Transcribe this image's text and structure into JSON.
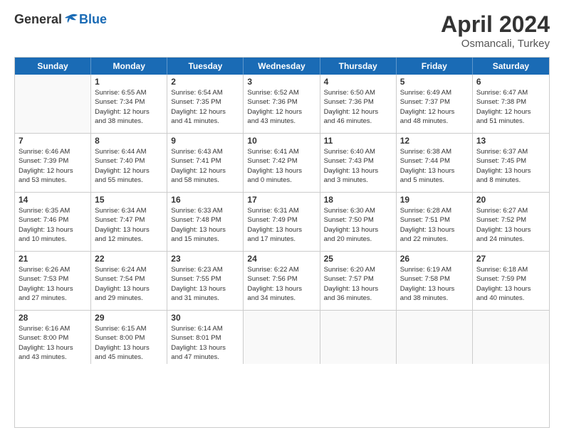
{
  "logo": {
    "general": "General",
    "blue": "Blue"
  },
  "title": {
    "month": "April 2024",
    "location": "Osmancali, Turkey"
  },
  "header": {
    "days": [
      "Sunday",
      "Monday",
      "Tuesday",
      "Wednesday",
      "Thursday",
      "Friday",
      "Saturday"
    ]
  },
  "weeks": [
    [
      {
        "day": "",
        "info": ""
      },
      {
        "day": "1",
        "info": "Sunrise: 6:55 AM\nSunset: 7:34 PM\nDaylight: 12 hours\nand 38 minutes."
      },
      {
        "day": "2",
        "info": "Sunrise: 6:54 AM\nSunset: 7:35 PM\nDaylight: 12 hours\nand 41 minutes."
      },
      {
        "day": "3",
        "info": "Sunrise: 6:52 AM\nSunset: 7:36 PM\nDaylight: 12 hours\nand 43 minutes."
      },
      {
        "day": "4",
        "info": "Sunrise: 6:50 AM\nSunset: 7:36 PM\nDaylight: 12 hours\nand 46 minutes."
      },
      {
        "day": "5",
        "info": "Sunrise: 6:49 AM\nSunset: 7:37 PM\nDaylight: 12 hours\nand 48 minutes."
      },
      {
        "day": "6",
        "info": "Sunrise: 6:47 AM\nSunset: 7:38 PM\nDaylight: 12 hours\nand 51 minutes."
      }
    ],
    [
      {
        "day": "7",
        "info": "Sunrise: 6:46 AM\nSunset: 7:39 PM\nDaylight: 12 hours\nand 53 minutes."
      },
      {
        "day": "8",
        "info": "Sunrise: 6:44 AM\nSunset: 7:40 PM\nDaylight: 12 hours\nand 55 minutes."
      },
      {
        "day": "9",
        "info": "Sunrise: 6:43 AM\nSunset: 7:41 PM\nDaylight: 12 hours\nand 58 minutes."
      },
      {
        "day": "10",
        "info": "Sunrise: 6:41 AM\nSunset: 7:42 PM\nDaylight: 13 hours\nand 0 minutes."
      },
      {
        "day": "11",
        "info": "Sunrise: 6:40 AM\nSunset: 7:43 PM\nDaylight: 13 hours\nand 3 minutes."
      },
      {
        "day": "12",
        "info": "Sunrise: 6:38 AM\nSunset: 7:44 PM\nDaylight: 13 hours\nand 5 minutes."
      },
      {
        "day": "13",
        "info": "Sunrise: 6:37 AM\nSunset: 7:45 PM\nDaylight: 13 hours\nand 8 minutes."
      }
    ],
    [
      {
        "day": "14",
        "info": "Sunrise: 6:35 AM\nSunset: 7:46 PM\nDaylight: 13 hours\nand 10 minutes."
      },
      {
        "day": "15",
        "info": "Sunrise: 6:34 AM\nSunset: 7:47 PM\nDaylight: 13 hours\nand 12 minutes."
      },
      {
        "day": "16",
        "info": "Sunrise: 6:33 AM\nSunset: 7:48 PM\nDaylight: 13 hours\nand 15 minutes."
      },
      {
        "day": "17",
        "info": "Sunrise: 6:31 AM\nSunset: 7:49 PM\nDaylight: 13 hours\nand 17 minutes."
      },
      {
        "day": "18",
        "info": "Sunrise: 6:30 AM\nSunset: 7:50 PM\nDaylight: 13 hours\nand 20 minutes."
      },
      {
        "day": "19",
        "info": "Sunrise: 6:28 AM\nSunset: 7:51 PM\nDaylight: 13 hours\nand 22 minutes."
      },
      {
        "day": "20",
        "info": "Sunrise: 6:27 AM\nSunset: 7:52 PM\nDaylight: 13 hours\nand 24 minutes."
      }
    ],
    [
      {
        "day": "21",
        "info": "Sunrise: 6:26 AM\nSunset: 7:53 PM\nDaylight: 13 hours\nand 27 minutes."
      },
      {
        "day": "22",
        "info": "Sunrise: 6:24 AM\nSunset: 7:54 PM\nDaylight: 13 hours\nand 29 minutes."
      },
      {
        "day": "23",
        "info": "Sunrise: 6:23 AM\nSunset: 7:55 PM\nDaylight: 13 hours\nand 31 minutes."
      },
      {
        "day": "24",
        "info": "Sunrise: 6:22 AM\nSunset: 7:56 PM\nDaylight: 13 hours\nand 34 minutes."
      },
      {
        "day": "25",
        "info": "Sunrise: 6:20 AM\nSunset: 7:57 PM\nDaylight: 13 hours\nand 36 minutes."
      },
      {
        "day": "26",
        "info": "Sunrise: 6:19 AM\nSunset: 7:58 PM\nDaylight: 13 hours\nand 38 minutes."
      },
      {
        "day": "27",
        "info": "Sunrise: 6:18 AM\nSunset: 7:59 PM\nDaylight: 13 hours\nand 40 minutes."
      }
    ],
    [
      {
        "day": "28",
        "info": "Sunrise: 6:16 AM\nSunset: 8:00 PM\nDaylight: 13 hours\nand 43 minutes."
      },
      {
        "day": "29",
        "info": "Sunrise: 6:15 AM\nSunset: 8:00 PM\nDaylight: 13 hours\nand 45 minutes."
      },
      {
        "day": "30",
        "info": "Sunrise: 6:14 AM\nSunset: 8:01 PM\nDaylight: 13 hours\nand 47 minutes."
      },
      {
        "day": "",
        "info": ""
      },
      {
        "day": "",
        "info": ""
      },
      {
        "day": "",
        "info": ""
      },
      {
        "day": "",
        "info": ""
      }
    ]
  ]
}
